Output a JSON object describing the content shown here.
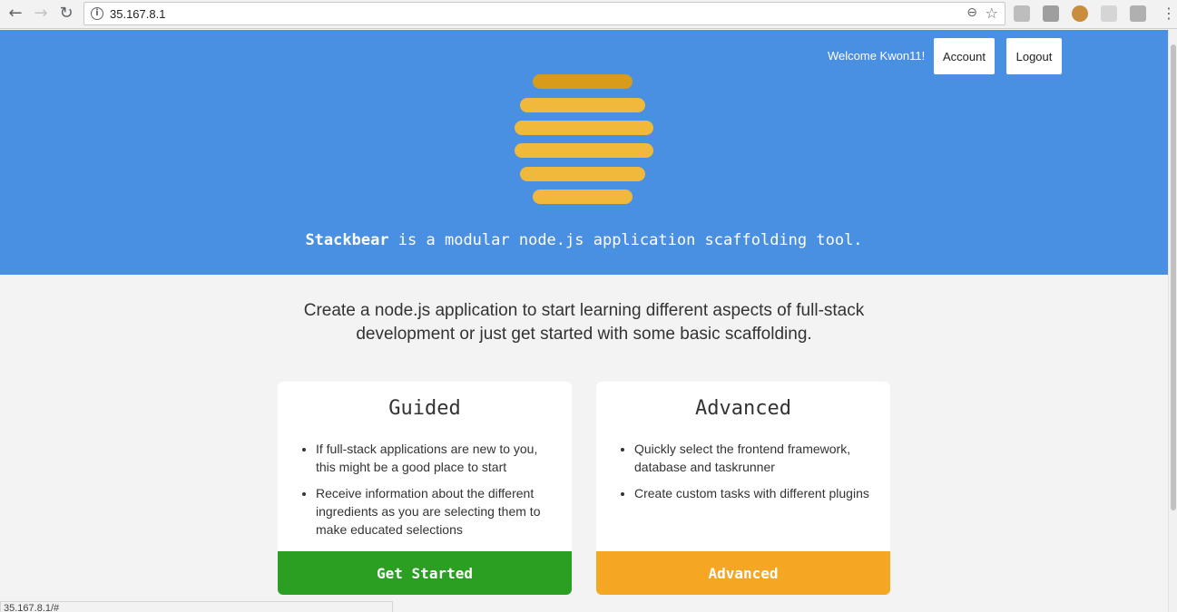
{
  "browser": {
    "url": "35.167.8.1",
    "status_url": "35.167.8.1/#",
    "back_icon": "arrow-left-icon",
    "forward_icon": "arrow-right-icon",
    "reload_icon": "reload-icon",
    "info_icon": "info-icon",
    "zoom_icon": "zoom-out-icon",
    "bookmark_icon": "star-icon",
    "menu_icon": "kebab-menu-icon"
  },
  "header": {
    "welcome": "Welcome Kwon11!",
    "account_label": "Account",
    "logout_label": "Logout"
  },
  "hero": {
    "brand": "Stackbear",
    "tagline_rest": " is a modular node.js application scaffolding tool.",
    "logo_colors": [
      "#d69c1a",
      "#f0b93b"
    ]
  },
  "intro": "Create a node.js application to start learning different aspects of full-stack development or just get started with some basic scaffolding.",
  "cards": [
    {
      "title": "Guided",
      "items": [
        "If full-stack applications are new to you, this might be a good place to start",
        "Receive information about the different ingredients as you are selecting them to make educated selections"
      ],
      "button": "Get Started",
      "button_color": "#2a9f22"
    },
    {
      "title": "Advanced",
      "items": [
        "Quickly select the frontend framework, database and taskrunner",
        "Create custom tasks with different plugins"
      ],
      "button": "Advanced",
      "button_color": "#f5a623"
    }
  ],
  "colors": {
    "hero_bg": "#4a90e2",
    "page_bg": "#f3f3f3"
  }
}
